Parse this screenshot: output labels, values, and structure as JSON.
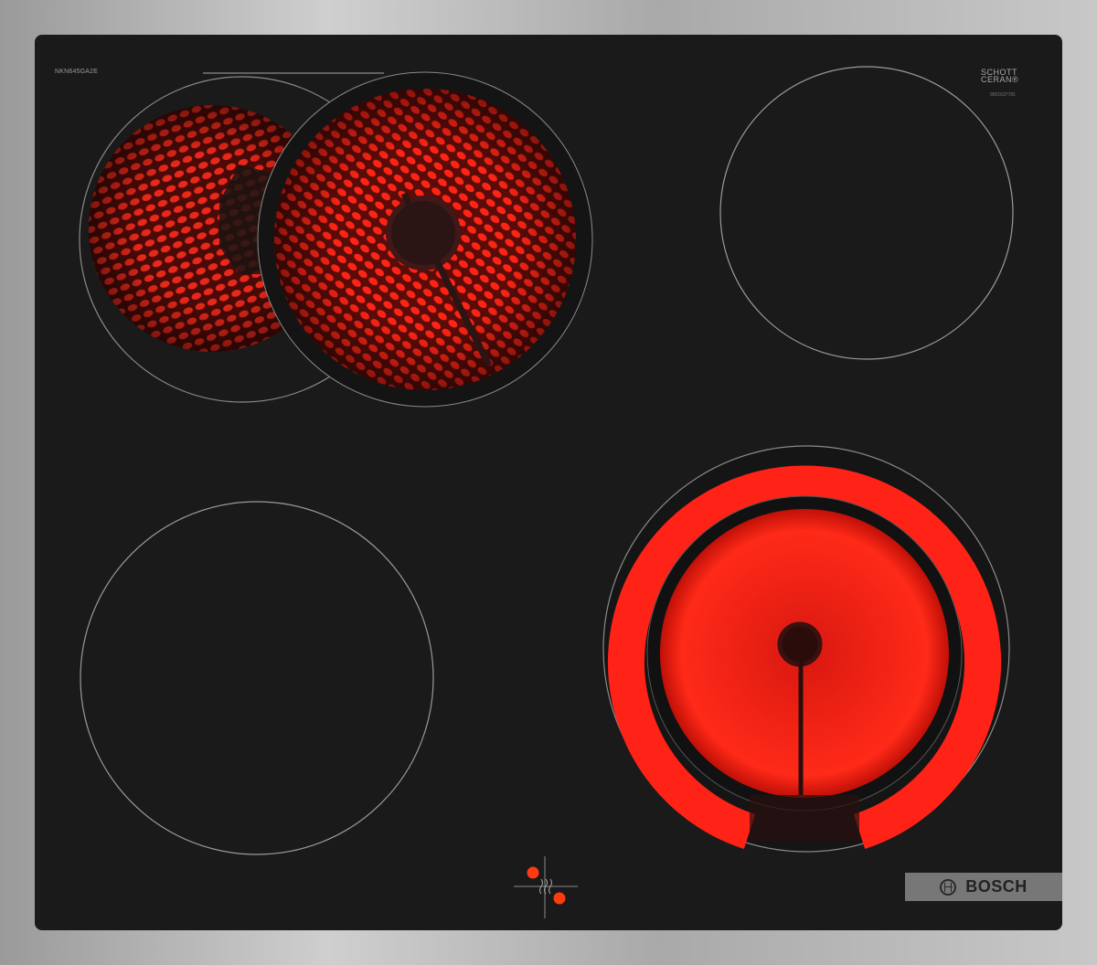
{
  "product": {
    "model_label": "NKN645GA2E",
    "glass_brand_line1": "SCHOTT",
    "glass_brand_line2": "CERAN®",
    "serial_label": "9001637781",
    "brand": "BOSCH"
  },
  "cooking_zones": [
    {
      "name": "front-left-dual-zone",
      "state": "on",
      "extension_state": "on"
    },
    {
      "name": "rear-right-zone",
      "state": "off"
    },
    {
      "name": "rear-left-zone",
      "state": "off"
    },
    {
      "name": "front-right-dual-zone",
      "state": "on",
      "extension_state": "on"
    }
  ],
  "controls": {
    "indicator_lights": 2,
    "symbol": "residual-heat"
  },
  "colors": {
    "glass": "#1a1a1a",
    "frame": "#b8b8b8",
    "heating": "#ff1a10",
    "badge": "#777777"
  }
}
